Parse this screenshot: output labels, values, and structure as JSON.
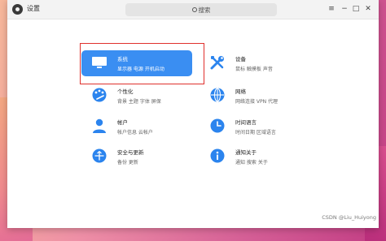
{
  "window": {
    "title": "设置"
  },
  "search": {
    "placeholder": "搜索"
  },
  "window_controls": {
    "menu": "≡",
    "minimize": "−",
    "maximize": "□",
    "close": "✕"
  },
  "cards": [
    {
      "id": "system",
      "title": "系统",
      "subtitle": "显示器  电源  开机启动",
      "icon": "monitor-icon",
      "active": true
    },
    {
      "id": "devices",
      "title": "设备",
      "subtitle": "鼠标  触摸板  声音",
      "icon": "tools-icon",
      "active": false
    },
    {
      "id": "personalization",
      "title": "个性化",
      "subtitle": "背景  主题  字体  屏保",
      "icon": "palette-icon",
      "active": false
    },
    {
      "id": "network",
      "title": "网络",
      "subtitle": "网络连接  VPN  代理",
      "icon": "globe-icon",
      "active": false
    },
    {
      "id": "account",
      "title": "帐户",
      "subtitle": "帐户信息  云帐户",
      "icon": "user-icon",
      "active": false
    },
    {
      "id": "time-language",
      "title": "时间语言",
      "subtitle": "时间日期  区域语言",
      "icon": "clock-icon",
      "active": false
    },
    {
      "id": "security-update",
      "title": "安全与更新",
      "subtitle": "备份  更新",
      "icon": "shield-update-icon",
      "active": false
    },
    {
      "id": "notifications-about",
      "title": "通知关于",
      "subtitle": "通知  搜索  关于",
      "icon": "info-icon",
      "active": false
    }
  ],
  "colors": {
    "accent": "#3a8ef2",
    "icon_blue": "#2b84ee",
    "highlight_box": "#e0302c"
  },
  "watermark": "CSDN @Liu_Huiyong"
}
